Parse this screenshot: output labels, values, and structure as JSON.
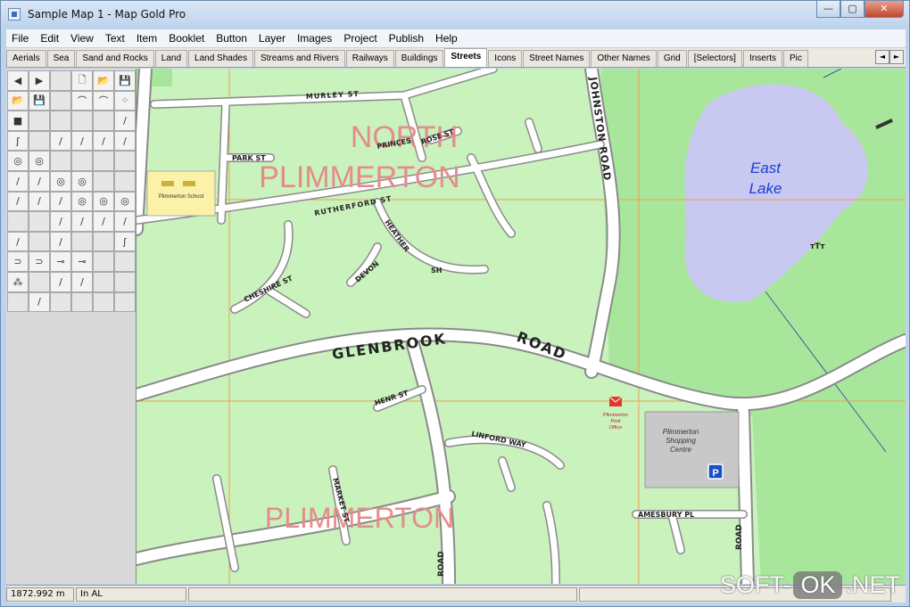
{
  "window": {
    "title": "Sample Map 1 - Map Gold Pro",
    "min_label": "—",
    "max_label": "▢",
    "close_label": "✕"
  },
  "menu": [
    "File",
    "Edit",
    "View",
    "Text",
    "Item",
    "Booklet",
    "Button",
    "Layer",
    "Images",
    "Project",
    "Publish",
    "Help"
  ],
  "tabs": [
    "Aerials",
    "Sea",
    "Sand and Rocks",
    "Land",
    "Land Shades",
    "Streams and Rivers",
    "Railways",
    "Buildings",
    "Streets",
    "Icons",
    "Street Names",
    "Other Names",
    "Grid",
    "[Selectors]",
    "Inserts",
    "Pic"
  ],
  "active_tab": "Streets",
  "tab_scroll": {
    "left": "◄",
    "right": "►"
  },
  "tools": [
    "◀",
    "▶",
    "",
    "🗋",
    "📂",
    "💾",
    "📂",
    "💾",
    "",
    "⌒",
    "⌒",
    "⁘",
    "■",
    "",
    "",
    "",
    "",
    "/",
    "ʃ",
    "",
    "/",
    "/",
    "/",
    "/",
    "◎",
    "◎",
    "",
    "",
    "",
    "",
    "/",
    "/",
    "◎",
    "◎",
    "",
    "",
    "/",
    "/",
    "/",
    "◎",
    "◎",
    "◎",
    "",
    "",
    "/",
    "/",
    "/",
    "/",
    "/",
    "",
    "/",
    "",
    "",
    "ʃ",
    "⊃",
    "⊃",
    "⊸",
    "⊸",
    "",
    "",
    "⁂",
    "",
    "/",
    "/",
    "",
    "",
    "",
    "/",
    "",
    "",
    "",
    ""
  ],
  "map": {
    "area_labels": [
      "NORTH",
      "PLIMMERTON",
      "PLIMMERTON"
    ],
    "lake_label": [
      "East",
      "Lake"
    ],
    "roads": {
      "glenbrook": "GLENBROOK ROAD",
      "johnston": "JOHNSTON ROAD",
      "murley": "MURLEY ST",
      "park": "PARK ST",
      "rutherford": "RUTHERFORD ST",
      "princes": "PRINCES",
      "rose": "ROSE ST",
      "heath": "HEATHER",
      "cheshire": "CHESHIRE ST",
      "devon": "DEVON",
      "sh": "SH",
      "amesbury": "AMESBURY PL",
      "henr": "HENR ST",
      "links": "LINFORD WAY",
      "road_side": "ROAD",
      "left_road": "ROAD",
      "market": "MARKET ST"
    },
    "shopping_label": [
      "Plimmerton",
      "Shopping",
      "Centre"
    ],
    "post_label": [
      "Plimmerton",
      "Post",
      "Office"
    ],
    "school_label": "Plimmerton School",
    "parking_symbol": "P",
    "colors": {
      "land": "#c9f2bd",
      "park": "#a8e79b",
      "lake": "#c8c8f0",
      "road": "#ffffff",
      "road_edge": "#8a8a8a",
      "grid": "#f0a050",
      "area_text": "#e58c8c",
      "lake_text": "#1b3fd0"
    }
  },
  "status": {
    "scale": "1872.992 m",
    "layer": "In  AL",
    "extra": ""
  },
  "watermark": {
    "left": "SOFT-",
    "ok": "OK",
    "right": ".NET"
  }
}
